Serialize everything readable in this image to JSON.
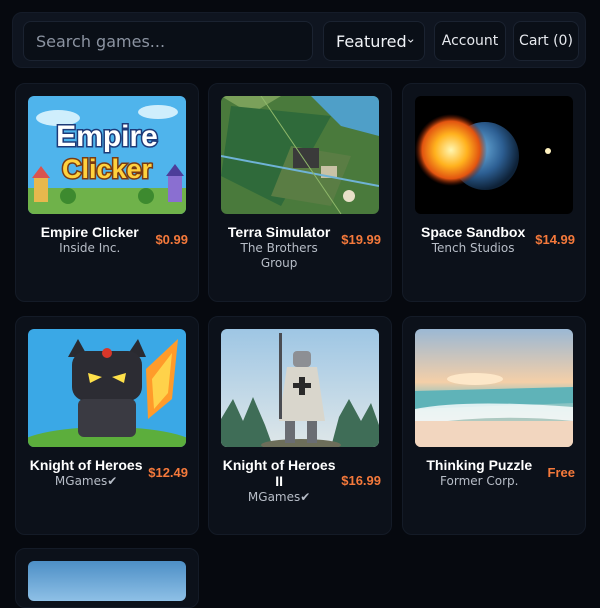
{
  "search": {
    "placeholder": "Search games..."
  },
  "sort": {
    "selected": "Featured"
  },
  "nav": {
    "account_label": "Account",
    "cart_label": "Cart (0)"
  },
  "products": [
    {
      "title": "Empire Clicker",
      "developer": "Inside Inc.",
      "price": "$0.99",
      "thumb_text_1": "Empire",
      "thumb_text_2": "Clicker"
    },
    {
      "title": "Terra Simulator",
      "developer": "The Brothers Group",
      "price": "$19.99"
    },
    {
      "title": "Space Sandbox",
      "developer": "Tench Studios",
      "price": "$14.99"
    },
    {
      "title": "Knight of Heroes",
      "developer": "MGames✔",
      "price": "$12.49"
    },
    {
      "title": "Knight of Heroes II",
      "developer": "MGames✔",
      "price": "$16.99"
    },
    {
      "title": "Thinking Puzzle",
      "developer": "Former Corp.",
      "price": "Free"
    },
    {
      "title": "",
      "developer": "",
      "price": ""
    }
  ],
  "colors": {
    "price_accent": "#f5793b",
    "background": "#06090f"
  }
}
